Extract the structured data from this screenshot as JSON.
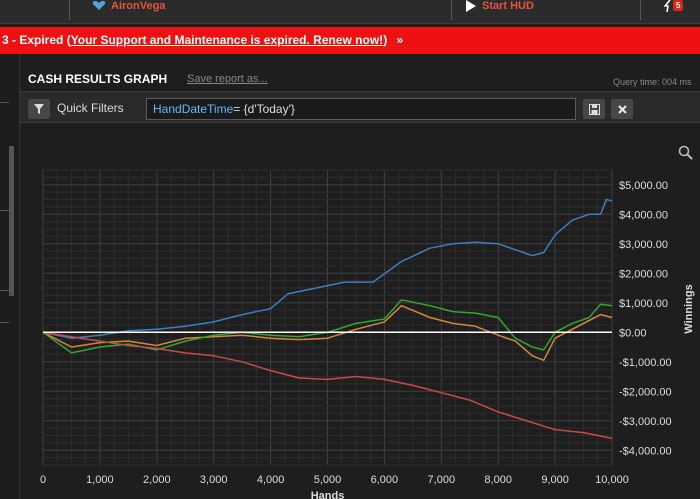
{
  "topbar": {
    "user_name": "AironVega",
    "start_hud_label": "Start HUD",
    "notification_count": "5"
  },
  "banner": {
    "prefix": "3 - Expired (",
    "link_text": "Your Support and Maintenance is expired.  Renew now!",
    "suffix": ")",
    "arrow": "»",
    "bg_color": "#ee1111"
  },
  "report": {
    "title": "CASH RESULTS GRAPH",
    "save_link": "Save report as...",
    "query_time": "Query time: 004 ms"
  },
  "filter": {
    "label": "Quick Filters",
    "value_keyword": "HandDateTime",
    "value_rest": "= {d'Today'}",
    "save_icon": "save-icon",
    "clear_icon": "close-icon"
  },
  "chart_data": {
    "type": "line",
    "xlabel": "Hands",
    "ylabel": "Winnings",
    "xlim": [
      0,
      10000
    ],
    "ylim": [
      -4500,
      5500
    ],
    "xticks": [
      "0",
      "1,000",
      "2,000",
      "3,000",
      "4,000",
      "5,000",
      "6,000",
      "7,000",
      "8,000",
      "9,000",
      "10,000"
    ],
    "xtick_values": [
      0,
      1000,
      2000,
      3000,
      4000,
      5000,
      6000,
      7000,
      8000,
      9000,
      10000
    ],
    "yticks": [
      "$5,000.00",
      "$4,000.00",
      "$3,000.00",
      "$2,000.00",
      "$1,000.00",
      "$0.00",
      "-$1,000.00",
      "-$2,000.00",
      "-$3,000.00",
      "-$4,000.00"
    ],
    "ytick_values": [
      5000,
      4000,
      3000,
      2000,
      1000,
      0,
      -1000,
      -2000,
      -3000,
      -4000
    ],
    "grid": true,
    "series": [
      {
        "color": "#3d7ec0",
        "x": [
          0,
          500,
          1000,
          1500,
          2000,
          2500,
          3000,
          3500,
          4000,
          4300,
          4800,
          5300,
          5800,
          6300,
          6800,
          7200,
          7600,
          8000,
          8300,
          8600,
          8800,
          9000,
          9300,
          9600,
          9800,
          9900,
          10000
        ],
        "y": [
          0,
          -200,
          -100,
          50,
          100,
          200,
          350,
          600,
          800,
          1300,
          1500,
          1700,
          1700,
          2400,
          2850,
          3000,
          3050,
          3000,
          2800,
          2600,
          2700,
          3300,
          3800,
          4000,
          4000,
          4500,
          4450
        ]
      },
      {
        "color": "#d2883a",
        "x": [
          0,
          500,
          1000,
          1500,
          2000,
          2500,
          3000,
          3500,
          4000,
          4500,
          5000,
          5500,
          6000,
          6300,
          6800,
          7200,
          7600,
          8000,
          8300,
          8600,
          8800,
          9000,
          9300,
          9600,
          9800,
          10000
        ],
        "y": [
          0,
          -500,
          -350,
          -300,
          -450,
          -200,
          -150,
          -100,
          -200,
          -250,
          -200,
          100,
          350,
          900,
          500,
          300,
          200,
          -100,
          -300,
          -800,
          -950,
          -200,
          100,
          400,
          600,
          500
        ]
      },
      {
        "color": "#32a632",
        "x": [
          0,
          500,
          1000,
          1500,
          2000,
          2500,
          3000,
          3500,
          4000,
          4500,
          5000,
          5500,
          6000,
          6300,
          6800,
          7200,
          7600,
          8000,
          8300,
          8600,
          8800,
          9000,
          9300,
          9600,
          9800,
          10000
        ],
        "y": [
          0,
          -700,
          -500,
          -400,
          -600,
          -300,
          -100,
          0,
          -100,
          -150,
          0,
          300,
          450,
          1100,
          900,
          700,
          650,
          500,
          -200,
          -500,
          -600,
          0,
          300,
          500,
          950,
          900
        ]
      },
      {
        "color": "#c84a4a",
        "x": [
          0,
          500,
          1000,
          1500,
          2000,
          2500,
          3000,
          3500,
          4000,
          4500,
          5000,
          5500,
          6000,
          6500,
          7000,
          7500,
          8000,
          8500,
          9000,
          9500,
          10000
        ],
        "y": [
          0,
          -150,
          -300,
          -450,
          -550,
          -700,
          -800,
          -1000,
          -1300,
          -1550,
          -1600,
          -1500,
          -1600,
          -1800,
          -2050,
          -2300,
          -2700,
          -3000,
          -3300,
          -3400,
          -3600
        ]
      },
      {
        "color": "#ffffff",
        "x": [
          0,
          10000
        ],
        "y": [
          0,
          0
        ]
      }
    ]
  }
}
